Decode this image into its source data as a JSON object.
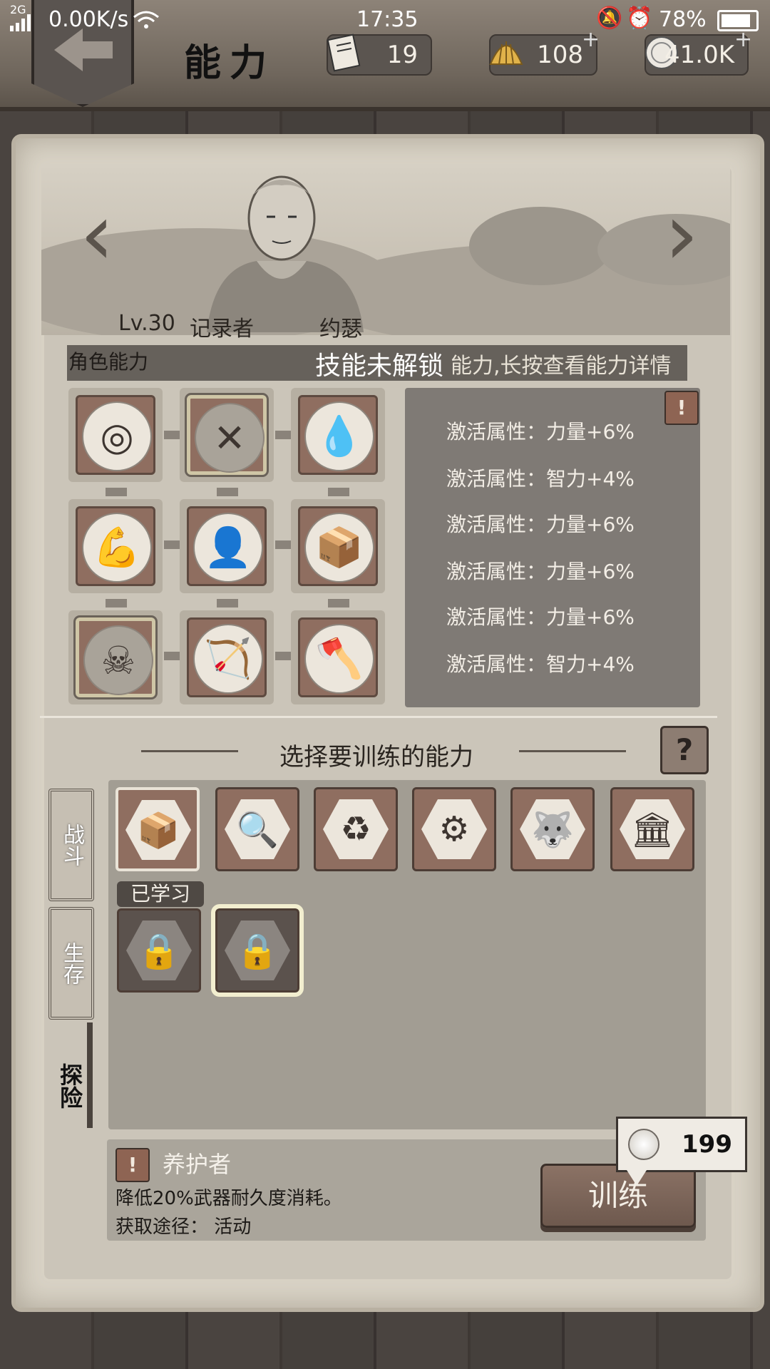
{
  "status_bar": {
    "network": "2G",
    "speed": "0.00K/s",
    "time": "17:35",
    "battery": "78%"
  },
  "header": {
    "title": "能力",
    "tickets": "19",
    "shells": "108",
    "coins": "41.0K",
    "plus": "+"
  },
  "character": {
    "level": "Lv.30",
    "role": "记录者",
    "name": "约瑟"
  },
  "abilities_label": "角色能力",
  "toast": "技能未解锁",
  "hint_tail": "能力,长按查看能力详情",
  "attributes": [
    "激活属性：力量+6%",
    "激活属性：智力+4%",
    "激活属性：力量+6%",
    "激活属性：力量+6%",
    "激活属性：力量+6%",
    "激活属性：智力+4%"
  ],
  "train_section": {
    "title": "选择要训练的能力",
    "help": "?",
    "tabs": [
      "战斗",
      "生存",
      "探险"
    ],
    "learned_badge": "已学习",
    "selected": {
      "name": "养护者",
      "description": "降低20%武器耐久度消耗。",
      "source": "获取途径：  活动"
    },
    "cost": "199",
    "train_button": "训练",
    "warn": "!"
  },
  "colors": {
    "accent": "#8f6e60",
    "panel": "#7f7a75",
    "parchment": "#d9d3c6"
  }
}
